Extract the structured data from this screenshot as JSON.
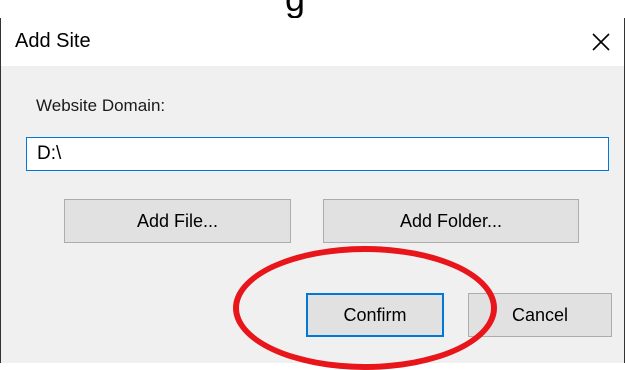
{
  "top_fragment": "g",
  "dialog": {
    "title": "Add Site",
    "close_icon": "close-icon",
    "domain_label": "Website Domain:",
    "domain_value": "D:\\",
    "add_file_label": "Add File...",
    "add_folder_label": "Add Folder...",
    "confirm_label": "Confirm",
    "cancel_label": "Cancel"
  },
  "colors": {
    "accent": "#0078d7",
    "highlight": "#e8151b",
    "dialog_bg": "#f0f0f0"
  }
}
